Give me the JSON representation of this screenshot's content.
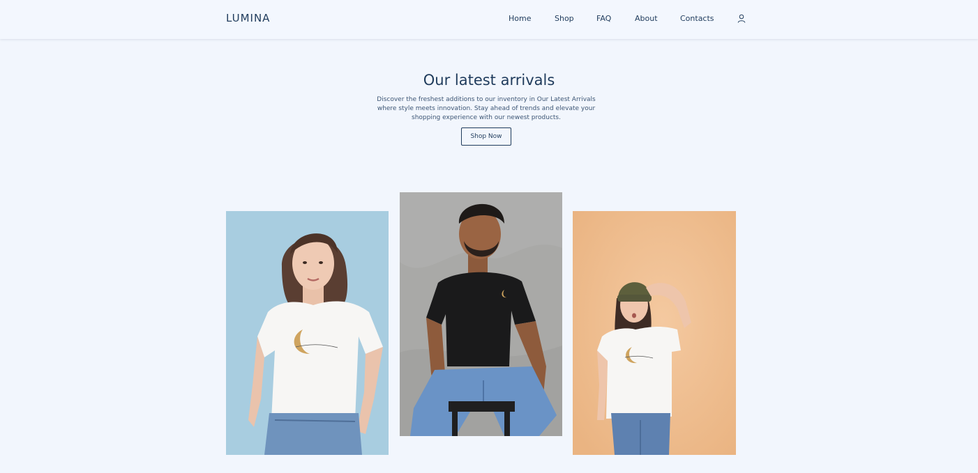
{
  "header": {
    "logo": "LUMINA",
    "nav": [
      {
        "label": "Home"
      },
      {
        "label": "Shop"
      },
      {
        "label": "FAQ"
      },
      {
        "label": "About"
      },
      {
        "label": "Contacts"
      }
    ],
    "user_icon": "user-icon"
  },
  "hero": {
    "title": "Our latest arrivals",
    "description": "Discover the freshest additions to our inventory in Our Latest Arrivals where style meets innovation. Stay ahead of trends and elevate your shopping experience with our newest products.",
    "button_label": "Shop Now"
  },
  "gallery": {
    "photos": [
      {
        "subject": "woman-white-tshirt",
        "background": "#a8cde0"
      },
      {
        "subject": "man-black-tshirt",
        "background": "#a9a9a7"
      },
      {
        "subject": "woman-beanie-white-tshirt",
        "background": "#efbf8e"
      }
    ]
  },
  "colors": {
    "page_background": "#f2f6fd",
    "text_primary": "#1f3b5c"
  }
}
